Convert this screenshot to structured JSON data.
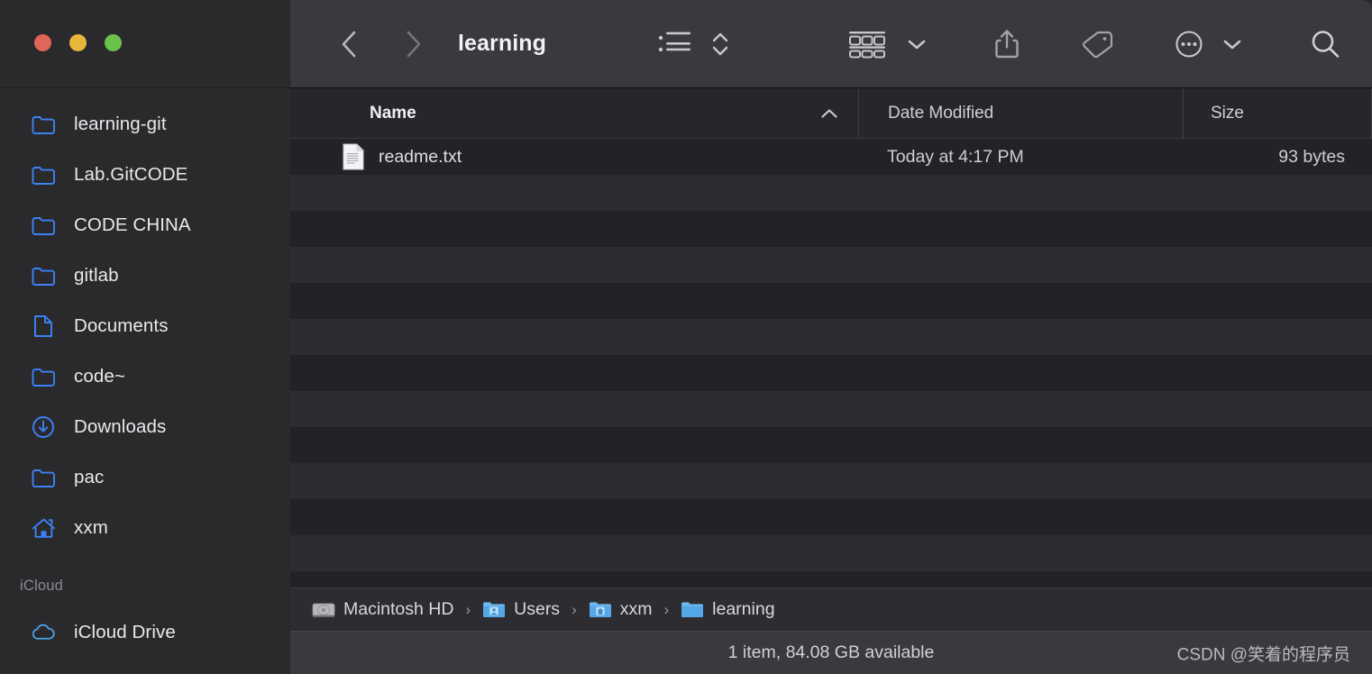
{
  "window": {
    "title": "learning",
    "traffic_lights": [
      {
        "name": "close",
        "color": "#e0655b"
      },
      {
        "name": "minimize",
        "color": "#e8b73a"
      },
      {
        "name": "maximize",
        "color": "#6bc24a"
      }
    ]
  },
  "toolbar": {
    "back_label": "Back",
    "forward_label": "Forward",
    "view_list_label": "List View",
    "view_arrange_label": "Arrange By",
    "share_label": "Share",
    "tag_label": "Tags",
    "more_label": "More",
    "search_label": "Search"
  },
  "sidebar": {
    "items": [
      {
        "label": "learning-git",
        "icon": "folder-icon"
      },
      {
        "label": "Lab.GitCODE",
        "icon": "folder-icon"
      },
      {
        "label": "CODE CHINA",
        "icon": "folder-icon"
      },
      {
        "label": "gitlab",
        "icon": "folder-icon"
      },
      {
        "label": "Documents",
        "icon": "document-icon"
      },
      {
        "label": "code~",
        "icon": "folder-icon"
      },
      {
        "label": "Downloads",
        "icon": "download-circle-icon"
      },
      {
        "label": "pac",
        "icon": "folder-icon"
      },
      {
        "label": "xxm",
        "icon": "home-icon"
      }
    ],
    "section_icloud": "iCloud",
    "icloud_items": [
      {
        "label": "iCloud Drive",
        "icon": "cloud-icon"
      }
    ]
  },
  "columns": {
    "name": "Name",
    "date_modified": "Date Modified",
    "size": "Size",
    "sort_direction": "ascending"
  },
  "files": [
    {
      "name": "readme.txt",
      "date_modified": "Today at 4:17 PM",
      "size": "93 bytes",
      "icon": "text-file-icon"
    }
  ],
  "breadcrumb": [
    {
      "label": "Macintosh HD",
      "icon": "harddisk-icon"
    },
    {
      "label": "Users",
      "icon": "users-folder-icon"
    },
    {
      "label": "xxm",
      "icon": "home-folder-icon"
    },
    {
      "label": "learning",
      "icon": "folder-blue-icon"
    }
  ],
  "breadcrumb_separator": "›",
  "status": {
    "text": "1 item, 84.08 GB available"
  },
  "watermark": {
    "text": "CSDN @笑着的程序员"
  },
  "colors": {
    "accent_blue": "#3b82f6",
    "sidebar_bg": "#2a2a2c",
    "toolbar_bg": "#3a3a3e",
    "row_odd": "#222227",
    "row_even": "#2c2c32"
  }
}
